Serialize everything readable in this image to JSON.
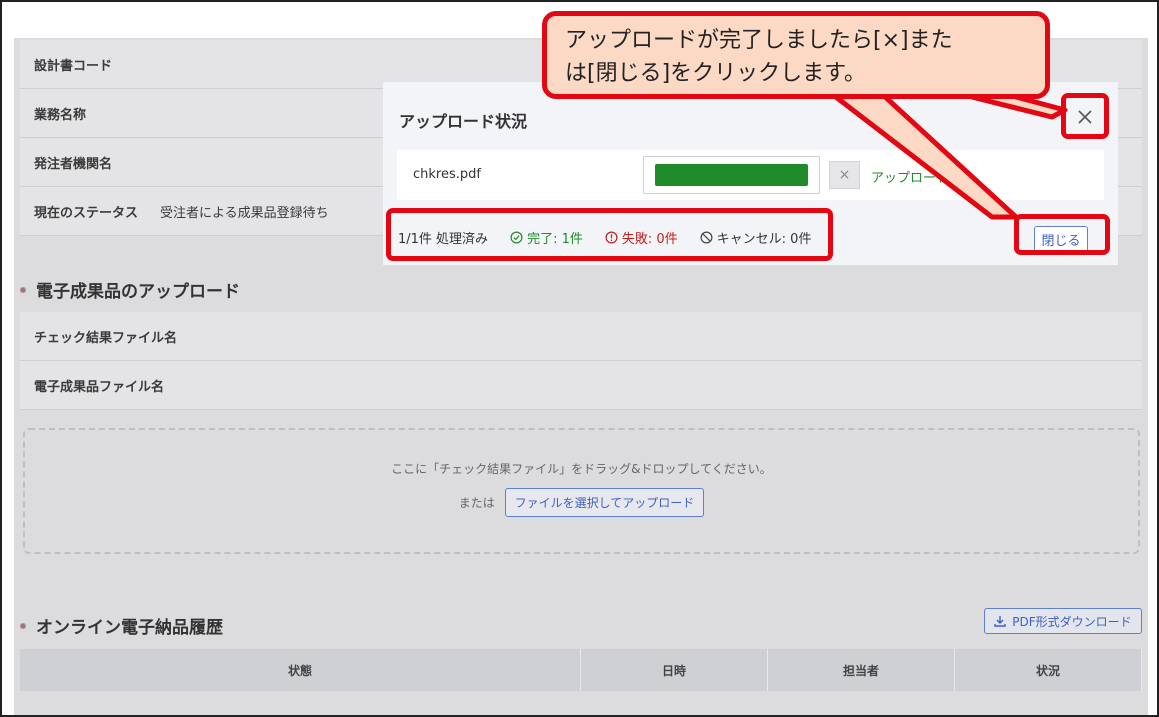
{
  "info": {
    "rows": [
      {
        "label": "設計書コード",
        "value": ""
      },
      {
        "label": "業務名称",
        "value": ""
      },
      {
        "label": "発注者機関名",
        "value": ""
      },
      {
        "label": "現在のステータス",
        "value": "受注者による成果品登録待ち"
      }
    ]
  },
  "upload_section": {
    "title": "電子成果品のアップロード",
    "rows": [
      "チェック結果ファイル名",
      "電子成果品ファイル名"
    ],
    "drop_text": "ここに「チェック結果ファイル」をドラッグ&ドロップしてください。",
    "or_text": "または",
    "select_button": "ファイルを選択してアップロード"
  },
  "history_section": {
    "title": "オンライン電子納品履歴",
    "pdf_button": "PDF形式ダウンロード",
    "columns": [
      "状態",
      "日時",
      "担当者",
      "状況"
    ]
  },
  "modal": {
    "title": "アップロード状況",
    "file_name": "chkres.pdf",
    "progress": 1.0,
    "cancel_label": "×",
    "status_link": "アップロード",
    "summary": {
      "processed": "1/1件 処理済み",
      "done": "完了: 1件",
      "failed": "失敗: 0件",
      "cancelled": "キャンセル: 0件"
    },
    "close_button": "閉じる",
    "close_icon": "close-icon"
  },
  "callout": {
    "line1": "アップロードが完了しましたら[×]また",
    "line2": "は[閉じる]をクリックします。"
  },
  "colors": {
    "highlight": "#e30613",
    "callout_bg": "#fbd9c4",
    "progress": "#1f8a2a",
    "link_blue": "#3f5fc2",
    "error": "#c0201e"
  }
}
